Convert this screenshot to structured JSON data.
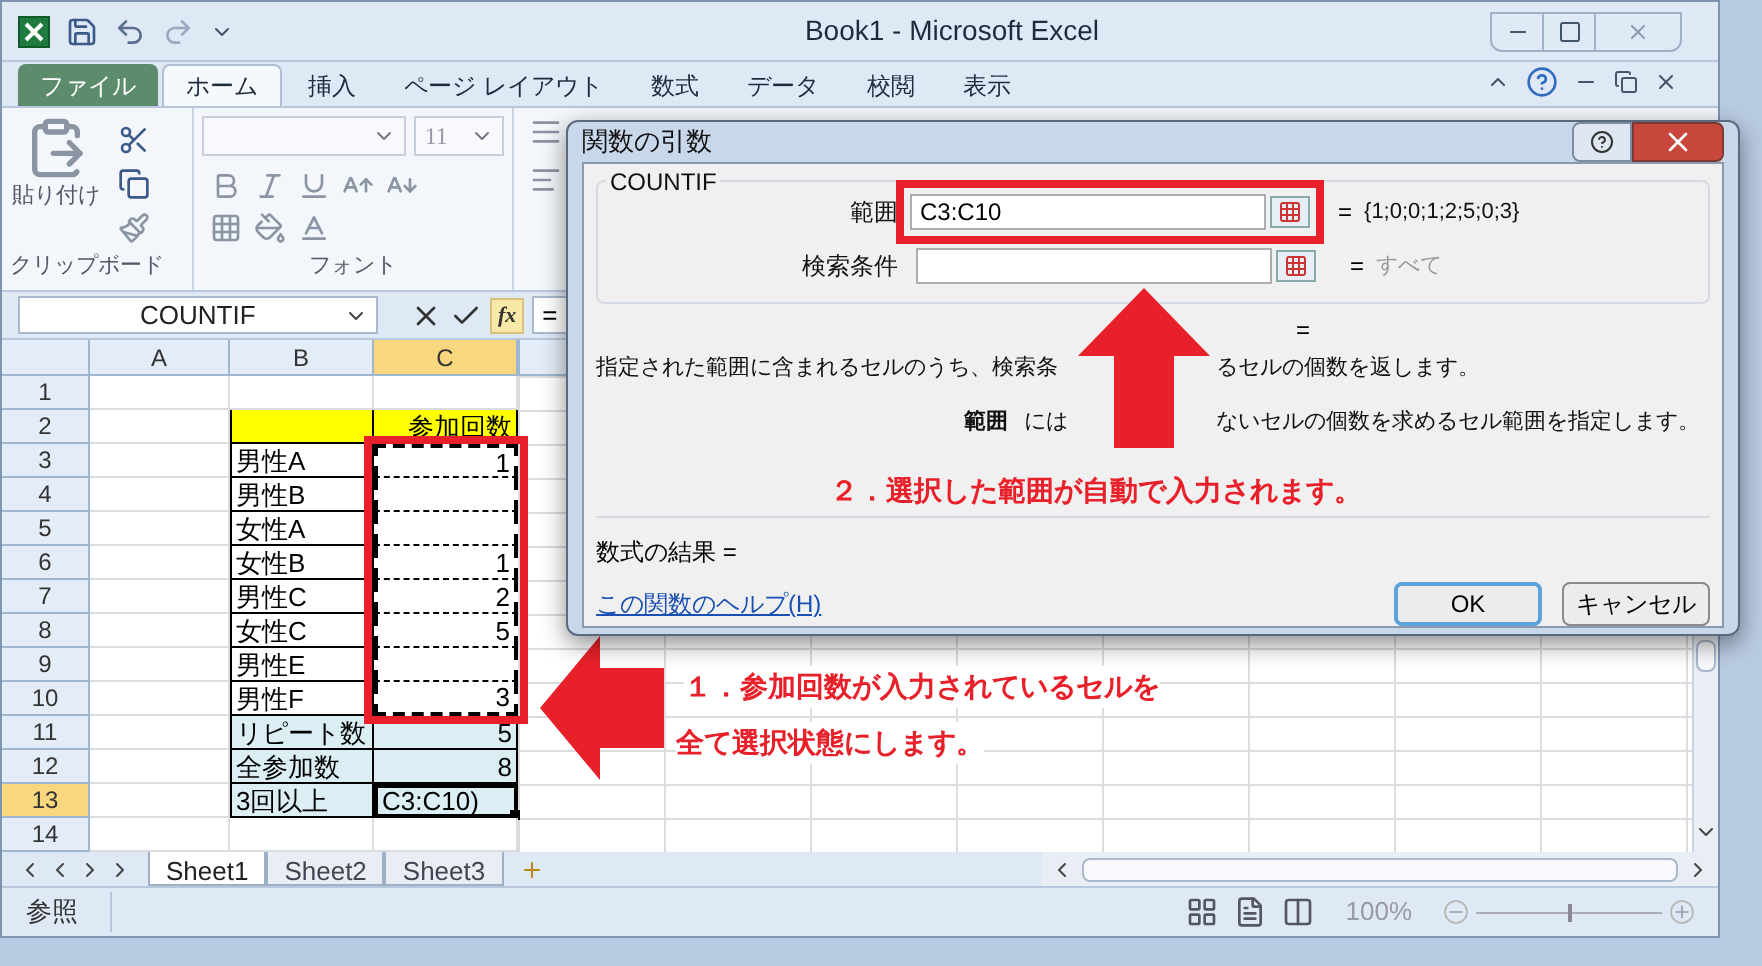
{
  "window": {
    "title": "Book1 - Microsoft Excel"
  },
  "ribbon_tabs": [
    {
      "label": "ファイル",
      "kind": "file",
      "selected": false
    },
    {
      "label": "ホーム",
      "kind": "tab",
      "selected": true
    },
    {
      "label": "挿入",
      "kind": "tab",
      "selected": false
    },
    {
      "label": "ページ レイアウト",
      "kind": "tab",
      "selected": false
    },
    {
      "label": "数式",
      "kind": "tab",
      "selected": false
    },
    {
      "label": "データ",
      "kind": "tab",
      "selected": false
    },
    {
      "label": "校閲",
      "kind": "tab",
      "selected": false
    },
    {
      "label": "表示",
      "kind": "tab",
      "selected": false
    }
  ],
  "ribbon": {
    "paste_label": "貼り付け",
    "font_size": "11",
    "groups": [
      "クリップボード",
      "フォント"
    ]
  },
  "formula_bar": {
    "name_box": "COUNTIF",
    "fx_label": "fx",
    "formula": "="
  },
  "sheet": {
    "columns": [
      {
        "label": "A",
        "selected": false
      },
      {
        "label": "B",
        "selected": false
      },
      {
        "label": "C",
        "selected": true
      }
    ],
    "rows": [
      {
        "number": "1",
        "selected": false,
        "cells": [
          {
            "kind": "blank",
            "marquee": false
          },
          {
            "kind": "blank",
            "marquee": false
          },
          {
            "kind": "blank",
            "marquee": false
          }
        ]
      },
      {
        "number": "2",
        "selected": false,
        "cells": [
          {
            "kind": "blank",
            "marquee": false
          },
          {
            "kind": "heading",
            "marquee": false
          },
          {
            "text": "参加回数",
            "kind": "heading",
            "marquee": false
          }
        ]
      },
      {
        "number": "3",
        "selected": false,
        "cells": [
          {
            "kind": "blank",
            "marquee": false
          },
          {
            "text": "男性A",
            "kind": "entry",
            "marquee": false
          },
          {
            "text": "1",
            "kind": "entry",
            "marquee": true
          }
        ]
      },
      {
        "number": "4",
        "selected": false,
        "cells": [
          {
            "kind": "blank",
            "marquee": false
          },
          {
            "text": "男性B",
            "kind": "entry",
            "marquee": false
          },
          {
            "kind": "entry",
            "marquee": true
          }
        ]
      },
      {
        "number": "5",
        "selected": false,
        "cells": [
          {
            "kind": "blank",
            "marquee": false
          },
          {
            "text": "女性A",
            "kind": "entry",
            "marquee": false
          },
          {
            "kind": "entry",
            "marquee": true
          }
        ]
      },
      {
        "number": "6",
        "selected": false,
        "cells": [
          {
            "kind": "blank",
            "marquee": false
          },
          {
            "text": "女性B",
            "kind": "entry",
            "marquee": false
          },
          {
            "text": "1",
            "kind": "entry",
            "marquee": true
          }
        ]
      },
      {
        "number": "7",
        "selected": false,
        "cells": [
          {
            "kind": "blank",
            "marquee": false
          },
          {
            "text": "男性C",
            "kind": "entry",
            "marquee": false
          },
          {
            "text": "2",
            "kind": "entry",
            "marquee": true
          }
        ]
      },
      {
        "number": "8",
        "selected": false,
        "cells": [
          {
            "kind": "blank",
            "marquee": false
          },
          {
            "text": "女性C",
            "kind": "entry",
            "marquee": false
          },
          {
            "text": "5",
            "kind": "entry",
            "marquee": true
          }
        ]
      },
      {
        "number": "9",
        "selected": false,
        "cells": [
          {
            "kind": "blank",
            "marquee": false
          },
          {
            "text": "男性E",
            "kind": "entry",
            "marquee": false
          },
          {
            "kind": "entry",
            "marquee": true
          }
        ]
      },
      {
        "number": "10",
        "selected": false,
        "cells": [
          {
            "kind": "blank",
            "marquee": false
          },
          {
            "text": "男性F",
            "kind": "entry",
            "marquee": false
          },
          {
            "text": "3",
            "kind": "entry",
            "marquee": true
          }
        ]
      },
      {
        "number": "11",
        "selected": false,
        "cells": [
          {
            "kind": "blank",
            "marquee": false
          },
          {
            "text": "リピート数",
            "kind": "summary",
            "marquee": false
          },
          {
            "text": "5",
            "kind": "summary",
            "marquee": false
          }
        ]
      },
      {
        "number": "12",
        "selected": false,
        "cells": [
          {
            "kind": "blank",
            "marquee": false
          },
          {
            "text": "全参加数",
            "kind": "summary",
            "marquee": false
          },
          {
            "text": "8",
            "kind": "summary",
            "marquee": false
          }
        ]
      },
      {
        "number": "13",
        "selected": true,
        "cells": [
          {
            "kind": "blank",
            "marquee": false
          },
          {
            "text": "3回以上",
            "kind": "summary",
            "marquee": false
          },
          {
            "text": "C3:C10)",
            "kind": "editing",
            "marquee": false
          }
        ]
      },
      {
        "number": "14",
        "selected": false,
        "cells": [
          {
            "kind": "blank",
            "marquee": false
          },
          {
            "kind": "blank",
            "marquee": false
          },
          {
            "kind": "blank",
            "marquee": false
          }
        ]
      }
    ]
  },
  "sheet_tabs": [
    {
      "label": "Sheet1",
      "selected": true
    },
    {
      "label": "Sheet2",
      "selected": false
    },
    {
      "label": "Sheet3",
      "selected": false
    }
  ],
  "status_bar": {
    "mode": "参照",
    "zoom": "100%",
    "zoom_slider": {
      "level": 0.5
    }
  },
  "dialog": {
    "title": "関数の引数",
    "function": "COUNTIF",
    "arguments": [
      {
        "label": "範囲",
        "value": "C3:C10",
        "equals": "=",
        "result": "{1;0;0;1;2;5;0;3}",
        "result_muted": false,
        "highlighted": true
      },
      {
        "label": "検索条件",
        "equals": "=",
        "result": "すべて",
        "result_muted": true,
        "highlighted": false
      }
    ],
    "formula_equals": "=",
    "description": [
      "指定された範囲に含まれるセルのうち、検索条",
      "るセルの個数を返します。"
    ],
    "argument_help": {
      "label": "範囲",
      "text": [
        "には",
        "ないセルの個数を求めるセル範囲を指定します。"
      ]
    },
    "result_label": "数式の結果 =",
    "help_link": "この関数のヘルプ(H)",
    "buttons": [
      {
        "label": "OK",
        "kind": "default"
      },
      {
        "label": "キャンセル",
        "kind": "normal"
      }
    ]
  },
  "annotations": {
    "step1": [
      "１．参加回数が入力されているセルを",
      "全て選択状態にします。"
    ],
    "step2": "２．選択した範囲が自動で入力されます。"
  }
}
